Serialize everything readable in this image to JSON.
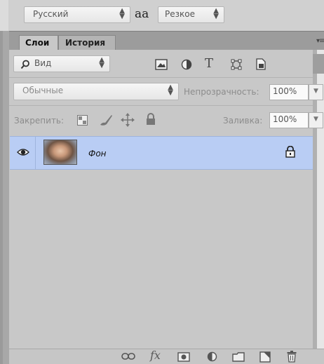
{
  "character_panel": {
    "language_select": "Русский",
    "aa_glyph": "aa",
    "antialias_select": "Резкое"
  },
  "tabs": {
    "layers": "Слои",
    "history": "История"
  },
  "panel_menu_icon": "panel-menu-icon",
  "filter": {
    "kind_label": "Вид",
    "icons": [
      "image-filter-icon",
      "adjustment-filter-icon",
      "type-filter-icon",
      "shape-filter-icon",
      "smart-object-filter-icon"
    ],
    "type_glyph": "T"
  },
  "blend": {
    "mode": "Обычные",
    "opacity_label": "Непрозрачность:",
    "opacity_value": "100%"
  },
  "lock": {
    "label": "Закрепить:",
    "icons": [
      "lock-transparent-pixels-icon",
      "lock-image-pixels-icon",
      "lock-position-icon",
      "lock-all-icon"
    ],
    "fill_label": "Заливка:",
    "fill_value": "100%"
  },
  "layers": [
    {
      "name": "Фон",
      "visible": true,
      "locked": true
    }
  ],
  "bottom_bar": {
    "fx_label": "fx",
    "icons": [
      "link-layers-icon",
      "layer-style-icon",
      "add-mask-icon",
      "adjustment-layer-icon",
      "new-group-icon",
      "new-layer-icon",
      "delete-layer-icon"
    ]
  },
  "colors": {
    "panel_bg": "#c8c8c8",
    "selected_row": "#b9cdf4"
  }
}
